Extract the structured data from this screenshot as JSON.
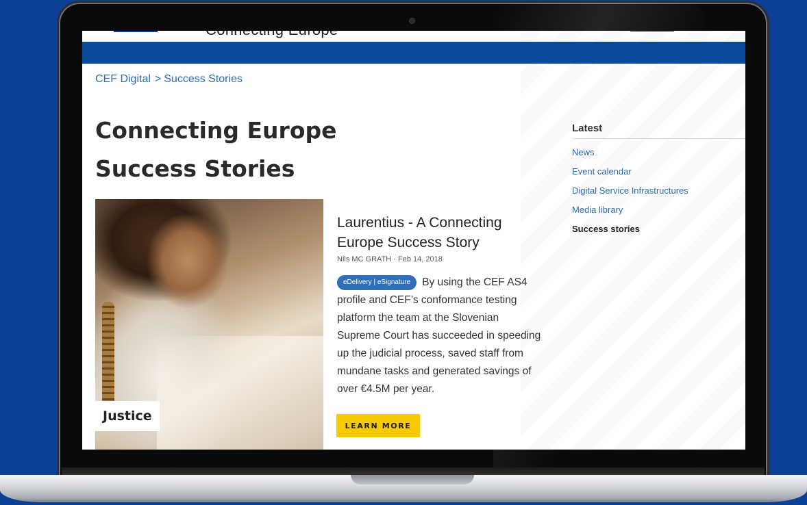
{
  "site": {
    "header_partial_text": "Connecting Europe"
  },
  "breadcrumb": {
    "root": "CEF Digital",
    "separator": ">",
    "current": "Success Stories"
  },
  "page": {
    "title": "Connecting Europe Success Stories"
  },
  "story": {
    "category": "Justice",
    "title": "Laurentius - A Connecting Europe Success Story",
    "author": "Nils MC GRATH",
    "date": "Feb 14, 2018",
    "meta_separator": "·",
    "tag": "eDelivery | eSignature",
    "summary": "By using the CEF AS4 profile and CEF’s conformance testing platform the team at the Slovenian Supreme Court has succeeded in speeding up the judicial process, saved staff from mundane tasks and generated savings of over €4.5M per year.",
    "cta_label": "LEARN MORE"
  },
  "sidebar": {
    "heading": "Latest",
    "items": [
      {
        "label": "News"
      },
      {
        "label": "Event calendar"
      },
      {
        "label": "Digital Service Infrastructures"
      },
      {
        "label": "Media library"
      },
      {
        "label": "Success stories"
      }
    ]
  },
  "colors": {
    "background": "#0c3f96",
    "nav": "#0b4a9c",
    "link": "#2b6cb0",
    "cta": "#f5cb00",
    "tag": "#2e6fb8"
  }
}
